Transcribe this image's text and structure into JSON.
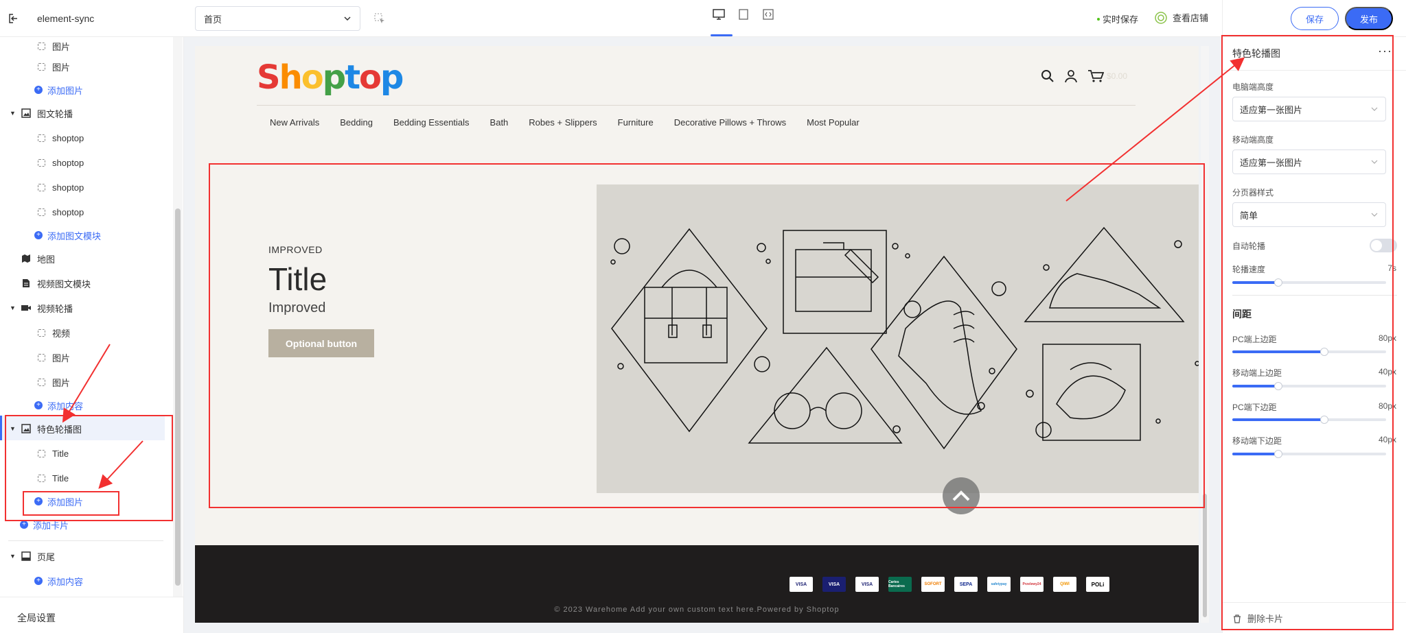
{
  "app": {
    "name": "element-sync"
  },
  "toolbar": {
    "page_select": "首页",
    "autosave": "实时保存",
    "view_shop": "查看店铺",
    "save": "保存",
    "publish": "发布"
  },
  "sidebar": {
    "items": [
      {
        "label": "图片",
        "type": "child"
      },
      {
        "label": "图片",
        "type": "child"
      },
      {
        "label": "添加图片",
        "type": "add"
      },
      {
        "label": "图文轮播",
        "type": "section"
      },
      {
        "label": "shoptop",
        "type": "child"
      },
      {
        "label": "shoptop",
        "type": "child"
      },
      {
        "label": "shoptop",
        "type": "child"
      },
      {
        "label": "shoptop",
        "type": "child"
      },
      {
        "label": "添加图文模块",
        "type": "add"
      },
      {
        "label": "地图",
        "type": "module"
      },
      {
        "label": "视频图文模块",
        "type": "module"
      },
      {
        "label": "视频轮播",
        "type": "section"
      },
      {
        "label": "视频",
        "type": "child"
      },
      {
        "label": "图片",
        "type": "child"
      },
      {
        "label": "图片",
        "type": "child"
      },
      {
        "label": "添加内容",
        "type": "add"
      },
      {
        "label": "特色轮播图",
        "type": "section"
      },
      {
        "label": "Title",
        "type": "child"
      },
      {
        "label": "Title",
        "type": "child"
      },
      {
        "label": "添加图片",
        "type": "add"
      },
      {
        "label": "添加卡片",
        "type": "add-top"
      },
      {
        "label": "页尾",
        "type": "section"
      },
      {
        "label": "添加内容",
        "type": "add"
      }
    ],
    "global_settings": "全局设置"
  },
  "store": {
    "logo": "Shoptop",
    "logo_colors": [
      "#e53935",
      "#fb8c00",
      "#fbc02d",
      "#43a047",
      "#1e88e5",
      "#e53935",
      "#1e88e5"
    ],
    "cart_amount": "$0.00",
    "menu": [
      "New Arrivals",
      "Bedding",
      "Bedding Essentials",
      "Bath",
      "Robes + Slippers",
      "Furniture",
      "Decorative Pillows + Throws",
      "Most Popular"
    ],
    "slide": {
      "subtitle": "IMPROVED",
      "title": "Title",
      "text": "Improved",
      "button": "Optional button"
    },
    "footer": {
      "payments": [
        "VISA",
        "VISA",
        "VISA",
        "Cartes Bancaires",
        "SOFORT",
        "SEPA",
        "safetypay",
        "Przelewy24",
        "QIWI",
        "POLi"
      ],
      "copyright": "© 2023 Warehome Add your own custom text here.Powered by Shoptop"
    }
  },
  "panel": {
    "title": "特色轮播图",
    "pc_height_label": "电脑端高度",
    "pc_height_value": "适应第一张图片",
    "mobile_height_label": "移动端高度",
    "mobile_height_value": "适应第一张图片",
    "pager_label": "分页器样式",
    "pager_value": "简单",
    "autoplay_label": "自动轮播",
    "autoplay": false,
    "speed_label": "轮播速度",
    "speed_value": "7s",
    "spacing_title": "间距",
    "spacing": [
      {
        "label": "PC端上边距",
        "value": "80px",
        "fraction": 0.6
      },
      {
        "label": "移动端上边距",
        "value": "40px",
        "fraction": 0.3
      },
      {
        "label": "PC端下边距",
        "value": "80px",
        "fraction": 0.6
      },
      {
        "label": "移动端下边距",
        "value": "40px",
        "fraction": 0.3
      }
    ],
    "speed_fraction": 0.3,
    "delete": "删除卡片"
  },
  "colors": {
    "accent": "#3b6bf5",
    "annotation": "#f23030",
    "footer_bg": "#1f1d1d",
    "button_bg": "#b8b0a0"
  }
}
